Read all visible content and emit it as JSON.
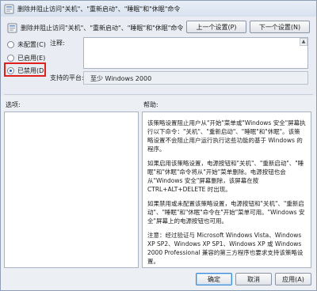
{
  "window": {
    "title": "删除并阻止访问\"关机\"、\"重新启动\"、\"睡眠\"和\"休眠\"命令"
  },
  "header": {
    "subtitle": "删除并阻止访问\"关机\"、\"重新启动\"、\"睡眠\"和\"休眠\"命令",
    "prev_label": "上一个设置(P)",
    "next_label": "下一个设置(N)"
  },
  "options": {
    "not_configured": "未配置(C)",
    "enabled": "已启用(E)",
    "disabled": "已禁用(D)",
    "selected": "disabled",
    "highlight_color": "#e0201c"
  },
  "comment": {
    "label": "注释:",
    "value": ""
  },
  "supported": {
    "label": "支持的平台:",
    "value": "至少 Windows 2000"
  },
  "sections": {
    "options_label": "选项:",
    "help_label": "帮助:"
  },
  "help": {
    "paragraphs": [
      "该策略设置阻止用户从\"开始\"菜单或\"Windows 安全\"屏幕执行以下命令：\"关机\"、\"重新启动\"、\"睡眠\"和\"休眠\"。该策略设置不会阻止用户运行执行这些功能的基于 Windows 的程序。",
      "如果启用该策略设置，电源按钮和\"关机\"、\"重新启动\"、\"睡眠\"和\"休眠\"命令将从\"开始\"菜单删除。电源按钮也会从\"Windows 安全\"屏幕删除，该屏幕在按 CTRL+ALT+DELETE 时出现。",
      "如果禁用或未配置该策略设置，电源按钮和\"关机\"、\"重新启动\"、\"睡眠\"和\"休眠\"命令在\"开始\"菜单可用。\"Windows 安全\"屏幕上的电源按钮也可用。",
      "注意：经过验证与 Microsoft Windows Vista、Windows XP SP2、Windows XP SP1、Windows XP 或 Windows 2000 Professional 兼容的第三方程序也要求支持该策略设置。"
    ]
  },
  "footer": {
    "ok_label": "确定",
    "cancel_label": "取消",
    "apply_label": "应用(A)"
  }
}
